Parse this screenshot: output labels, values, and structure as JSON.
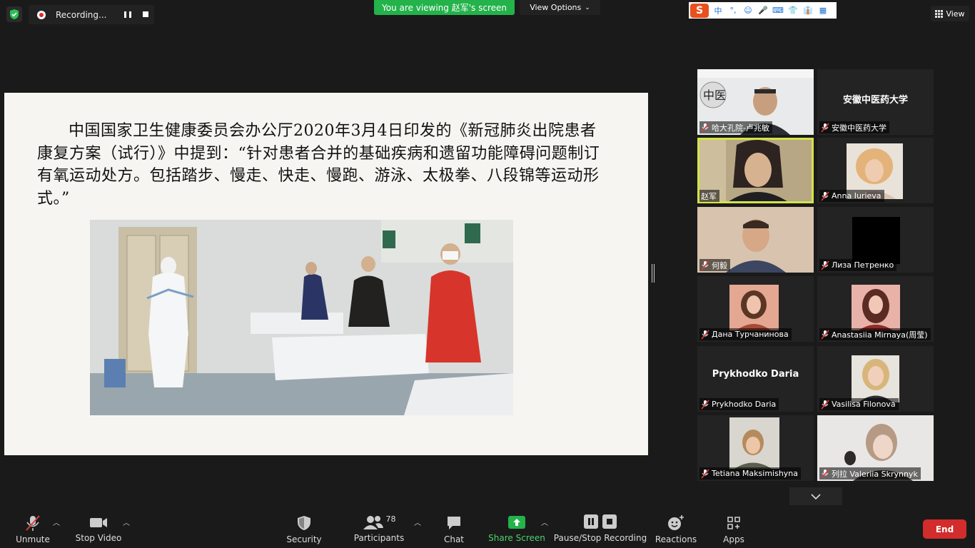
{
  "recording": {
    "label": "Recording..."
  },
  "banner": {
    "viewing": "You are viewing 赵军's screen",
    "view_options": "View Options"
  },
  "ime": {
    "logo": "S",
    "items": [
      "中",
      "°,",
      "☺",
      "🎤",
      "⌨",
      "👕",
      "👔",
      "▦"
    ]
  },
  "top_view": {
    "label": "View"
  },
  "slide": {
    "text": "中国国家卫生健康委员会办公厅2020年3月4日印发的《新冠肺炎出院患者康复方案（试行）》中提到：“针对患者合并的基础疾病和遗留功能障碍问题制订有氧运动处方。包括踏步、慢走、快走、慢跑、游泳、太极拳、八段锦等运动形式。”"
  },
  "participants": [
    {
      "name": "哈大孔院-卢兆敏",
      "type": "video"
    },
    {
      "name": "安徽中医药大学",
      "type": "name",
      "big": "安徽中医药大学"
    },
    {
      "name": "赵军",
      "type": "video",
      "active": true
    },
    {
      "name": "Anna Iurieva",
      "type": "photo"
    },
    {
      "name": "何毅",
      "type": "video"
    },
    {
      "name": "Лиза Петренко",
      "type": "black"
    },
    {
      "name": "Дана Турчанинова",
      "type": "photo"
    },
    {
      "name": "Anastasiia Mirnaya(周莹)",
      "type": "photo"
    },
    {
      "name": "Prykhodko Daria",
      "type": "name",
      "big": "Prykhodko Daria"
    },
    {
      "name": "Vasilisa Filonova",
      "type": "photo"
    },
    {
      "name": "Tetiana Maksimishyna",
      "type": "photo"
    },
    {
      "name": "列拉 Valeriia Skrynnyk",
      "type": "video"
    }
  ],
  "toolbar": {
    "unmute": "Unmute",
    "stop_video": "Stop Video",
    "security": "Security",
    "participants": "Participants",
    "participants_count": "78",
    "chat": "Chat",
    "share_screen": "Share Screen",
    "pause_stop_recording": "Pause/Stop Recording",
    "reactions": "Reactions",
    "apps": "Apps",
    "end": "End"
  },
  "colors": {
    "share_green": "#24b24b",
    "end_red": "#d22c2c",
    "active_speaker": "#d4e34a"
  }
}
